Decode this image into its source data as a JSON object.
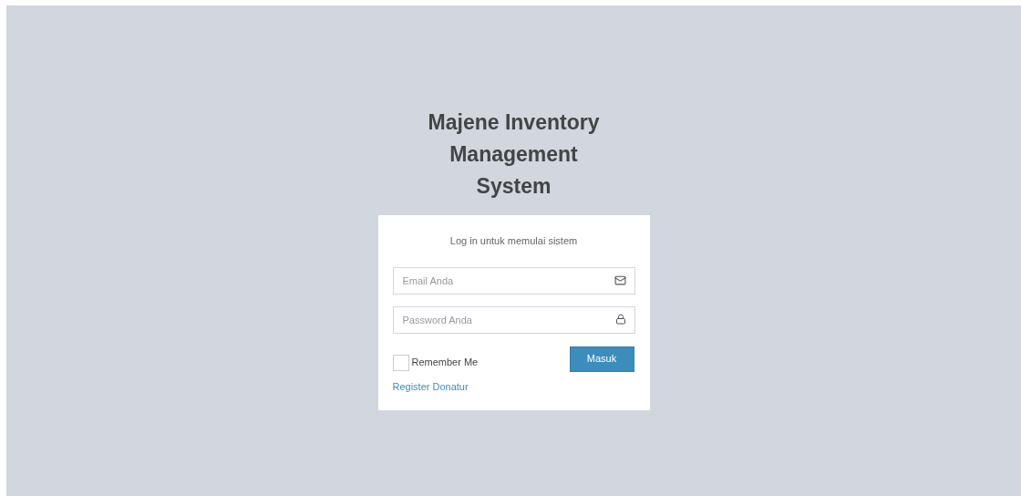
{
  "title_lines": [
    "Majene Inventory",
    "Management",
    "System"
  ],
  "card": {
    "message": "Log in untuk memulai sistem",
    "fields": [
      {
        "kind": "email",
        "placeholder": "Email Anda"
      },
      {
        "kind": "password",
        "placeholder": "Password Anda"
      }
    ],
    "remember": {
      "label": "Remember Me",
      "checked": false
    },
    "submit": "Masuk",
    "register_link": "Register Donatur"
  }
}
